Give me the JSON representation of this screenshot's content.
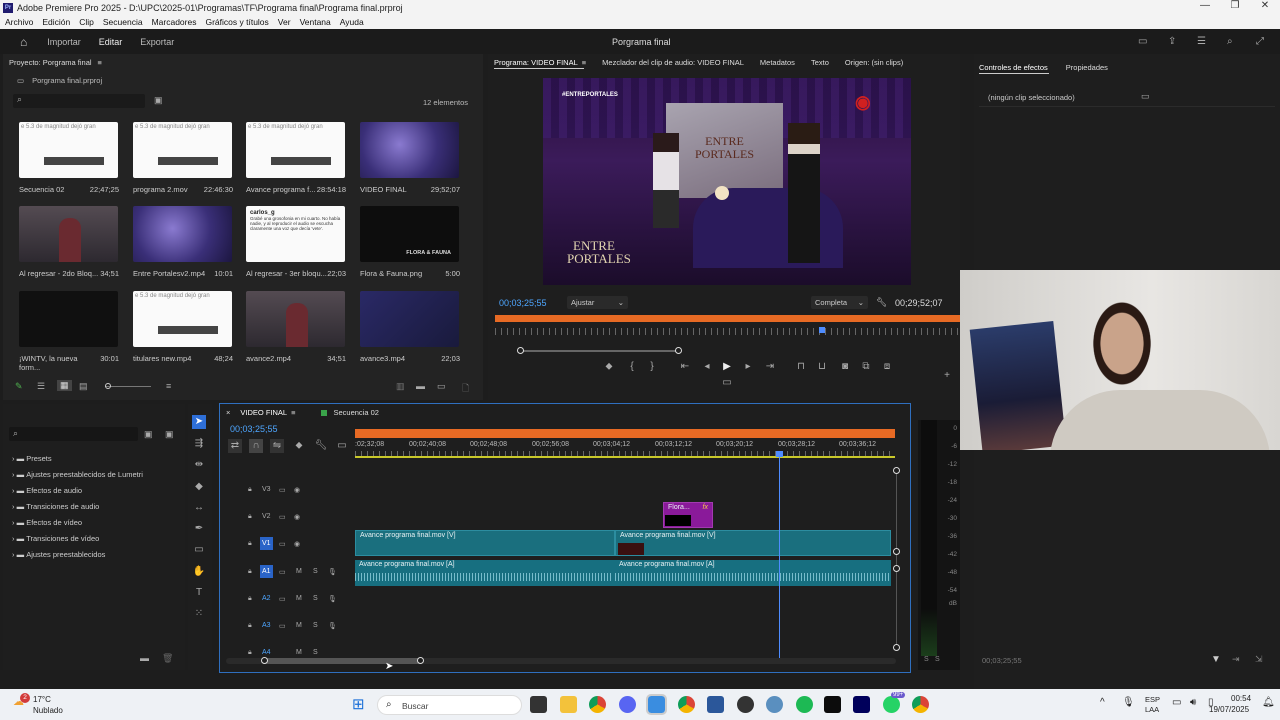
{
  "window": {
    "title": "Adobe Premiere Pro 2025 - D:\\UPC\\2025-01\\Programas\\TF\\Programa final\\Programa final.prproj"
  },
  "menu": [
    "Archivo",
    "Edición",
    "Clip",
    "Secuencia",
    "Marcadores",
    "Gráficos y títulos",
    "Ver",
    "Ventana",
    "Ayuda"
  ],
  "topbar": {
    "import": "Importar",
    "edit": "Editar",
    "export": "Exportar",
    "project_title": "Porgrama final"
  },
  "project": {
    "panel_title": "Proyecto: Porgrama final",
    "file": "Porgrama final.prproj",
    "count": "12 elementos",
    "items": [
      {
        "name": "Secuencia 02",
        "dur": "22;47;25"
      },
      {
        "name": "programa 2.mov",
        "dur": "22:46:30"
      },
      {
        "name": "Avance programa f...",
        "dur": "28:54:18"
      },
      {
        "name": "VIDEO FINAL",
        "dur": "29;52;07"
      },
      {
        "name": "Al regresar - 2do Bloq...",
        "dur": "34;51"
      },
      {
        "name": "Entre Portalesv2.mp4",
        "dur": "10:01"
      },
      {
        "name": "Al regresar - 3er bloqu...",
        "dur": "22;03"
      },
      {
        "name": "Flora & Fauna.png",
        "dur": "5:00"
      },
      {
        "name": "¡WINTV, la nueva form...",
        "dur": "30:01"
      },
      {
        "name": "titulares new.mp4",
        "dur": "48;24"
      },
      {
        "name": "avance2.mp4",
        "dur": "34;51"
      },
      {
        "name": "avance3.mp4",
        "dur": "22;03"
      }
    ],
    "thumb_texts": {
      "doc_header": "e 5.3 de magnitud dejó gran",
      "tweet_user": "carlos_g",
      "tweet_text": "Grabé una grosofonia en mi cuarto. No había nadie, y al reproducir el audio se escucha claramente una voz que decía 'vete'.",
      "flora_label": "FLORA & FAUNA"
    }
  },
  "monitor": {
    "tabs": [
      "Programa: VIDEO FINAL",
      "Mezclador del clip de audio: VIDEO FINAL",
      "Metadatos",
      "Texto",
      "Origen: (sin clips)"
    ],
    "timecode": "00;03;25;55",
    "fit": "Ajustar",
    "quality": "Completa",
    "duration": "00;29;52;07",
    "overlay_hashtag": "#ENTREPORTALES",
    "overlay_logo_line1": "ENTRE",
    "overlay_logo_line2": "PORTALES",
    "screen_line1": "ENTRE",
    "screen_line2": "PORTALES"
  },
  "effects": {
    "tabs": [
      "Controles de efectos",
      "Propiedades"
    ],
    "empty": "(ningún clip seleccionado)",
    "timecode": "00;03;25;55"
  },
  "effects_browser": {
    "items": [
      "Presets",
      "Ajustes preestablecidos de Lumetri",
      "Efectos de audio",
      "Transiciones de audio",
      "Efectos de vídeo",
      "Transiciones de vídeo",
      "Ajustes preestablecidos"
    ]
  },
  "timeline": {
    "tabs": [
      "VIDEO FINAL",
      "Secuencia 02"
    ],
    "timecode": "00;03;25;55",
    "ruler": [
      ":02;32;08",
      "00;02;40;08",
      "00;02;48;08",
      "00;02;56;08",
      "00;03;04;12",
      "00;03;12;12",
      "00;03;20;12",
      "00;03;28;12",
      "00;03;36;12"
    ],
    "tracks": [
      "V3",
      "V2",
      "V1",
      "A1",
      "A2",
      "A3",
      "A4"
    ],
    "clip_v1a": "Avance programa final.mov [V]",
    "clip_v1b": "Avance programa final.mov [V]",
    "clip_a1a": "Avance programa final.mov [A]",
    "clip_a1b": "Avance programa final.mov [A]",
    "clip_v2": "Flora...",
    "fx": "fx",
    "track_m": "M",
    "track_s": "S"
  },
  "meter": {
    "labels": [
      "0",
      "-6",
      "-12",
      "-18",
      "-24",
      "-30",
      "-36",
      "-42",
      "-48",
      "-54",
      "dB"
    ],
    "solo": "S",
    "solo2": "S"
  },
  "taskbar": {
    "temp": "17°C",
    "weather": "Nublado",
    "search": "Buscar",
    "lang1": "ESP",
    "lang2": "LAA",
    "time": "00:54",
    "date": "19/07/2025",
    "badge": "2",
    "badge2": "99+"
  }
}
